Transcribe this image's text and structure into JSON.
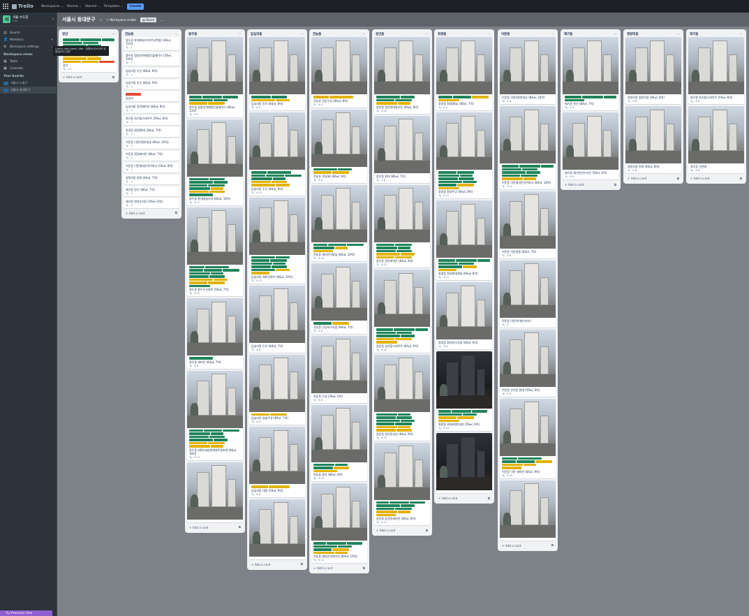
{
  "topbar": {
    "brand": "Trello",
    "nav": [
      "Workspaces",
      "Recent",
      "Starred",
      "Templates"
    ],
    "create": "Create"
  },
  "sidebar": {
    "workspace_name": "서울 수도권",
    "workspace_plan": "Free",
    "workspace_initial": "서",
    "items": [
      {
        "icon": "board-icon",
        "label": "Boards"
      },
      {
        "icon": "members-icon",
        "label": "Members"
      },
      {
        "icon": "gear-icon",
        "label": "Workspace settings"
      }
    ],
    "views_title": "Workspace views",
    "views": [
      {
        "icon": "table-icon",
        "label": "Table"
      },
      {
        "icon": "calendar-icon",
        "label": "Calendar"
      }
    ],
    "boards_title": "Your boards",
    "boards": [
      "서울시 노원구",
      "서울시 동대문구"
    ],
    "premium": "Try Premium free",
    "tooltip": "Colour: bold green, title: \"공원/녹지/소규모 공원/놀이터 있음\""
  },
  "board": {
    "title": "서울시 동대문구",
    "visibility": "Workspace visible",
    "view": "Board"
  },
  "add_card_label": "+ Add a card",
  "colors": {
    "green": "#1f845a",
    "yellow": "#e2b203",
    "red": "#e34935",
    "background": "#7d8188"
  },
  "lists": [
    {
      "title": "장안",
      "cards": [
        {
          "photo": false,
          "labels": "gggggggggggyyyyyyr",
          "title": "장안",
          "badges": "13"
        }
      ]
    },
    {
      "title": "전농동",
      "cards": [
        {
          "photo": false,
          "title": "용두동 롯데캐슬리치(주상복합) (84㎡, 11억)",
          "badges": "1"
        },
        {
          "photo": false,
          "title": "용두동 청량리역해링턴플레이스 (59㎡, 10억)",
          "badges": "1"
        },
        {
          "photo": false,
          "title": "답십리동 두산 (84㎡, 8억)",
          "badges": "1"
        },
        {
          "photo": false,
          "title": "답십리동 두산 (84㎡, 9억)",
          "badges": "1"
        },
        {
          "photo": false,
          "labels": "r",
          "title": "답십리",
          "badges": ""
        },
        {
          "photo": false,
          "title": "답십리동 동아래미안 (84㎡, 8억)",
          "badges": "1"
        },
        {
          "photo": false,
          "title": "회기동 회기힐스테이트 (59㎡, 8억)",
          "badges": "1"
        },
        {
          "photo": false,
          "title": "휘경동 휘경SK뷰 (84㎡, 7억)",
          "badges": "1"
        },
        {
          "photo": false,
          "title": "이문동 이문e편한세상 (84㎡, 10억)",
          "badges": "1"
        },
        {
          "photo": false,
          "title": "이문동 휘경래미안 (84㎡, 7억)",
          "badges": "1"
        },
        {
          "photo": false,
          "title": "이문동 이문래미안아이파크 (59㎡, 8억)",
          "badges": "1"
        },
        {
          "photo": false,
          "title": "청량리동 현대 (84㎡, 7억)",
          "badges": "1"
        },
        {
          "photo": false,
          "title": "제기동 한신 (84㎡, 7억)",
          "badges": "1"
        },
        {
          "photo": false,
          "title": "제기동 한양수자인 (59㎡, 6억)",
          "badges": "1"
        }
      ]
    },
    {
      "title": "용두동",
      "cards": [
        {
          "photo": true,
          "labels": "gggggyy",
          "title": "용두동 청량리역해링턴플레이스 (84㎡, 13억)",
          "badges": "6 9"
        },
        {
          "photo": true,
          "labels": "gggggggyyyg",
          "title": "용두동 롯데캐슬리치 (84㎡, 10억)",
          "badges": "6 11"
        },
        {
          "photo": true,
          "labels": "gggggggggyyyyg",
          "title": "용두동 용두두산위브 (59㎡, 7억)",
          "badges": "6 12"
        },
        {
          "photo": true,
          "labels": "g",
          "title": "용두동 래미안 (84㎡, 7억)",
          "badges": "6 8"
        },
        {
          "photo": true,
          "labels": "gggggggggyyyy",
          "title": "용두동 e편한세상청계센트럴포레 (84㎡, 10억)",
          "badges": "6 13"
        },
        {
          "photo": true,
          "labels": "",
          "title": "",
          "badges": ""
        }
      ]
    },
    {
      "title": "답십리동",
      "cards": [
        {
          "photo": true,
          "labels": "ggyy",
          "title": "답십리동 동아 (84㎡, 8억)",
          "badges": "6 9"
        },
        {
          "photo": true,
          "labels": "gggggggyyyy",
          "title": "답십리동 두산 (84㎡, 8억)",
          "badges": "6 12"
        },
        {
          "photo": true,
          "labels": "gggggggggyy",
          "title": "답십리동 래미안위브 (84㎡, 10억)",
          "badges": "6 12"
        },
        {
          "photo": true,
          "labels": "",
          "title": "답십리동 두산 (84㎡, 7억)",
          "badges": "6 8"
        },
        {
          "photo": true,
          "labels": "yy",
          "title": "답십리동 청솔우성 (84㎡, 7억)",
          "badges": "6 9"
        },
        {
          "photo": true,
          "labels": "yy",
          "title": "답십리동 대원 (59㎡, 6억)",
          "badges": "6 8"
        },
        {
          "photo": true,
          "labels": "",
          "title": "",
          "badges": ""
        }
      ]
    },
    {
      "title": "전농동",
      "cards": [
        {
          "photo": true,
          "labels": "yy",
          "title": "전농동 전농우성 (84㎡, 8억)",
          "badges": "6 9"
        },
        {
          "photo": true,
          "labels": "ggyy",
          "title": "전농동 전농SK (84㎡, 9억)",
          "badges": "6 9"
        },
        {
          "photo": true,
          "labels": "ggggyy",
          "title": "전농동 래미안아름숲 (84㎡, 10억)",
          "badges": "6 10"
        },
        {
          "photo": true,
          "labels": "gy",
          "title": "전농동 신성미소지움 (84㎡, 7억)",
          "badges": "6 8"
        },
        {
          "photo": true,
          "labels": "",
          "title": "전농동 우성 (59㎡, 6억)",
          "badges": "6 8"
        },
        {
          "photo": true,
          "labels": "gggyy",
          "title": "전농동 동아 (84㎡, 8억)",
          "badges": "6 10"
        },
        {
          "photo": true,
          "labels": "ggggggyyy",
          "title": "전농동 래미안크레시티 (84㎡, 10억)",
          "badges": "6 12"
        }
      ]
    },
    {
      "title": "장안동",
      "cards": [
        {
          "photo": true,
          "labels": "ggggyy",
          "title": "장안동 장안현대홈타운 (84㎡, 8억)",
          "badges": "6 10"
        },
        {
          "photo": true,
          "labels": "",
          "title": "장안동 현대 (84㎡, 7억)",
          "badges": "6 8"
        },
        {
          "photo": true,
          "labels": "ggggggyyyy",
          "title": "장안동 장안래미안 (84㎡, 8억)",
          "badges": "6 12"
        },
        {
          "photo": true,
          "labels": "gggggggyyy",
          "title": "장안동 장안힐스테이트 (84㎡, 9억)",
          "badges": "6 12"
        },
        {
          "photo": true,
          "labels": "ggggggggyyyy",
          "title": "장안동 장안동삼성 (84㎡, 8억)",
          "badges": "6 13"
        },
        {
          "photo": true,
          "labels": "gggggggyyy",
          "title": "장안동 장안동래미안 (84㎡, 8억)",
          "badges": "6 12"
        }
      ]
    },
    {
      "title": "휘경동",
      "cards": [
        {
          "photo": true,
          "labels": "ggyy",
          "title": "휘경동 휘경SK뷰 (84㎡, 7억)",
          "badges": "6 9"
        },
        {
          "photo": true,
          "labels": "gggggggggyy",
          "title": "휘경동 휘경주공 (84㎡, 8억)",
          "badges": "6 12"
        },
        {
          "photo": true,
          "labels": "ggggggyy",
          "title": "휘경동 휘경롯데캐슬 (84㎡, 8억)",
          "badges": "6 11"
        },
        {
          "photo": true,
          "labels": "",
          "title": "휘경동 휘경미소지움 (84㎡, 6억)",
          "badges": "6 8"
        },
        {
          "photo": true,
          "labels": "gggggyyy",
          "title": "휘경동 휘경e편한세상 (59㎡, 6억)",
          "badges": "6 10"
        },
        {
          "photo": true,
          "labels": "",
          "title": "",
          "badges": ""
        }
      ]
    },
    {
      "title": "이문동",
      "cards": [
        {
          "photo": true,
          "labels": "",
          "title": "이문동 이문e편한세상 (84㎡, 10억)",
          "badges": "6 8"
        },
        {
          "photo": true,
          "labels": "gggggggggyy",
          "title": "이문동 이문래미안아이파크 (84㎡, 10억)",
          "badges": "6 12"
        },
        {
          "photo": true,
          "labels": "",
          "title": "이문동 이문쌍용 (84㎡, 7억)",
          "badges": "6 8"
        },
        {
          "photo": true,
          "labels": "",
          "title": "이문동 이문아이파크자이",
          "badges": "6"
        },
        {
          "photo": true,
          "labels": "",
          "title": "이문동 신이문 현대 (59㎡, 6억)",
          "badges": "6 8"
        },
        {
          "photo": true,
          "labels": "ggggyyyy",
          "title": "이문동 이문 래미안 (84㎡, 9억)",
          "badges": "6 10"
        },
        {
          "photo": true,
          "labels": "",
          "title": "",
          "badges": ""
        }
      ]
    },
    {
      "title": "제기동",
      "cards": [
        {
          "photo": true,
          "labels": "gggg",
          "title": "제기동 한신 (84㎡, 7억)",
          "badges": "6 9"
        },
        {
          "photo": true,
          "labels": "",
          "title": "제기동 제기한양수자인 (59㎡, 6억)",
          "badges": "6 8"
        }
      ]
    },
    {
      "title": "청량리동",
      "cards": [
        {
          "photo": true,
          "labels": "",
          "title": "청량리동 청량리동 (84㎡, 8억)",
          "badges": "6 8"
        },
        {
          "photo": true,
          "labels": "",
          "title": "청량리동 현대 (84㎡, 8억)",
          "badges": "6 8"
        }
      ]
    },
    {
      "title": "회기동",
      "cards": [
        {
          "photo": true,
          "labels": "",
          "title": "회기동 회기힐스테이트 (59㎡, 8억)",
          "badges": "6 8"
        },
        {
          "photo": true,
          "labels": "",
          "title": "회기동 신현대",
          "badges": "6 8"
        }
      ]
    }
  ]
}
